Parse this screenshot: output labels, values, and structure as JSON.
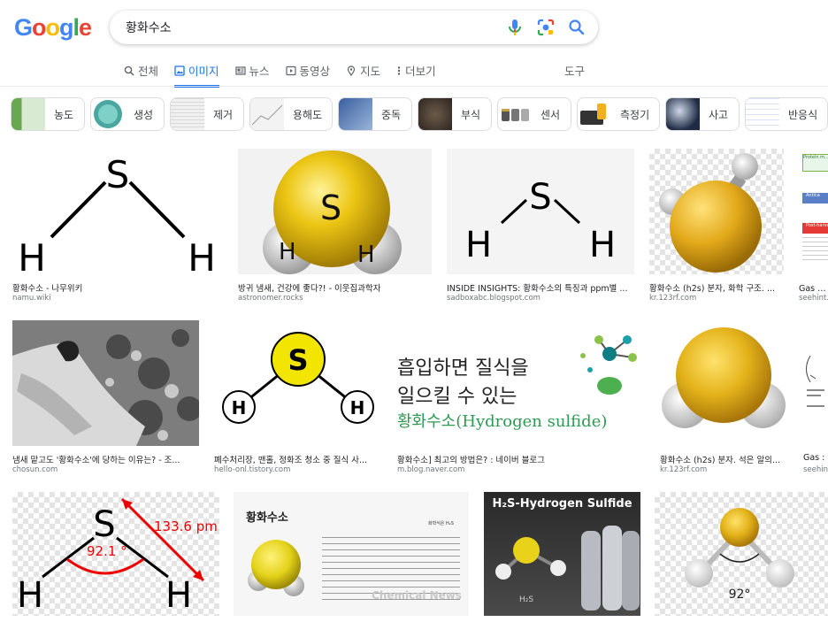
{
  "logo": {
    "letters": [
      "G",
      "o",
      "o",
      "g",
      "l",
      "e"
    ],
    "colors": [
      "#4285f4",
      "#ea4335",
      "#fbbc05",
      "#4285f4",
      "#34a853",
      "#ea4335"
    ]
  },
  "search": {
    "query": "황화수소"
  },
  "tabs": [
    {
      "label": "전체",
      "icon": "search-icon",
      "active": false
    },
    {
      "label": "이미지",
      "icon": "image-icon",
      "active": true
    },
    {
      "label": "뉴스",
      "icon": "news-icon",
      "active": false
    },
    {
      "label": "동영상",
      "icon": "video-icon",
      "active": false
    },
    {
      "label": "지도",
      "icon": "map-pin-icon",
      "active": false
    },
    {
      "label": "더보기",
      "icon": "more-vert-icon",
      "active": false
    }
  ],
  "tools_label": "도구",
  "chips": [
    {
      "label": "농도"
    },
    {
      "label": "생성"
    },
    {
      "label": "제거"
    },
    {
      "label": "용해도"
    },
    {
      "label": "중독"
    },
    {
      "label": "부식"
    },
    {
      "label": "센서"
    },
    {
      "label": "측정기"
    },
    {
      "label": "사고"
    },
    {
      "label": "반응식"
    }
  ],
  "results": [
    {
      "title": "황화수소 - 나무위키",
      "source": "namu.wiki"
    },
    {
      "title": "방귀 냄새, 건강에 좋다?! - 이웃집과학자",
      "source": "astronomer.rocks"
    },
    {
      "title": "INSIDE INSIGHTS: 황화수소의 특징과 ppm별 ...",
      "source": "sadboxabc.blogspot.com"
    },
    {
      "title": "황화수소 (h2s) 분자, 화학 구조. ...",
      "source": "kr.123rf.com"
    },
    {
      "title": "Gas : 황",
      "source": "seehint."
    },
    {
      "title": "냄새 맡고도 '황화수소'에 당하는 이유는? - 조...",
      "source": "chosun.com"
    },
    {
      "title": "폐수처리장, 맨홀, 정화조 청소 중 질식 사...",
      "source": "hello-onl.tistory.com"
    },
    {
      "title": "황화수소] 최고의 방법은? : 네이버 블로그",
      "source": "m.blog.naver.com"
    },
    {
      "title": "황화수소 (h2s) 분자. 석은 알의...",
      "source": "kr.123rf.com"
    },
    {
      "title": "Gas :",
      "source": "seehin"
    }
  ],
  "img_text": {
    "s": "S",
    "h": "H",
    "bond_length": "133.6 pm",
    "angle1": "92.1 °",
    "angle2": "92°",
    "korean_poster": [
      "흡입하면 질식을",
      "일으킬 수 있는",
      "황화수소(Hydrogen sulfide)"
    ],
    "article_title": "황화수소",
    "article_formula": "화학식은 H₂S",
    "article_watermark": "Chemical News",
    "h2s_banner": "H₂S-Hydrogen Sulfide",
    "h2s_small": "H₂S",
    "infographic_head": "Protein m... by perse",
    "infographic_items": [
      "Antica",
      "Post-harve"
    ]
  },
  "colors": {
    "accent": "#1a73e8",
    "sulfur": "#e8c21a",
    "sulfur_dark": "#c7950c",
    "poster_green": "#2d9a52"
  }
}
